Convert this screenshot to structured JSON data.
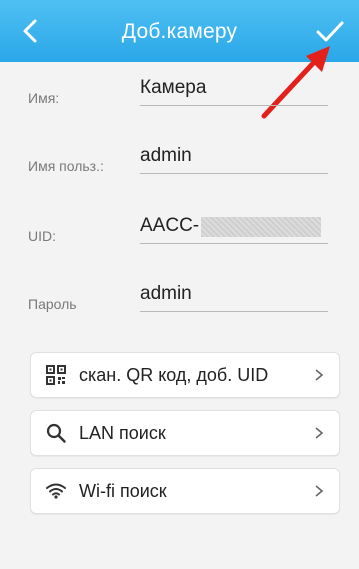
{
  "header": {
    "title": "Доб.камеру",
    "bg_color": "#38b2ec",
    "back_icon": "chevron-left-icon",
    "confirm_icon": "checkmark-icon"
  },
  "form": {
    "name": {
      "label": "Имя:",
      "value": "Камера"
    },
    "username": {
      "label": "Имя польз.:",
      "value": "admin"
    },
    "uid": {
      "label": "UID:",
      "value": "AACC-"
    },
    "password": {
      "label": "Пароль",
      "value": "admin"
    }
  },
  "actions": [
    {
      "label": "скан. QR код, доб. UID",
      "icon": "qr-code-icon"
    },
    {
      "label": "LAN поиск",
      "icon": "search-icon"
    },
    {
      "label": "Wi-fi поиск",
      "icon": "wifi-icon"
    }
  ],
  "annotation": {
    "arrow_color": "#e4201b"
  }
}
